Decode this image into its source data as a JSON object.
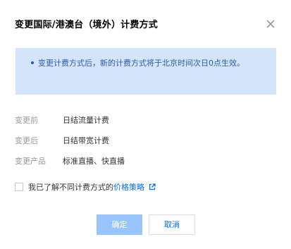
{
  "dialog": {
    "title": "变更国际/港澳台（境外）计费方式",
    "close_icon": "close-icon"
  },
  "notice": {
    "text": "变更计费方式后，新的计费方式将于北京时间次日0点生效。"
  },
  "details": [
    {
      "label": "变更前",
      "value": "日结流量计费"
    },
    {
      "label": "变更后",
      "value": "日结带宽计费"
    },
    {
      "label": "变更产品",
      "value": "标准直播、快直播"
    }
  ],
  "agreement": {
    "checked": false,
    "text": "我已了解不同计费方式的",
    "link_text": "价格策略",
    "link_icon": "external-link-icon"
  },
  "buttons": {
    "confirm_label": "确定",
    "cancel_label": "取消"
  },
  "colors": {
    "accent": "#006eff",
    "notice_bg": "#d4e4fa",
    "notice_text": "#2a5ba8",
    "confirm_disabled_bg": "#99c5ff"
  }
}
